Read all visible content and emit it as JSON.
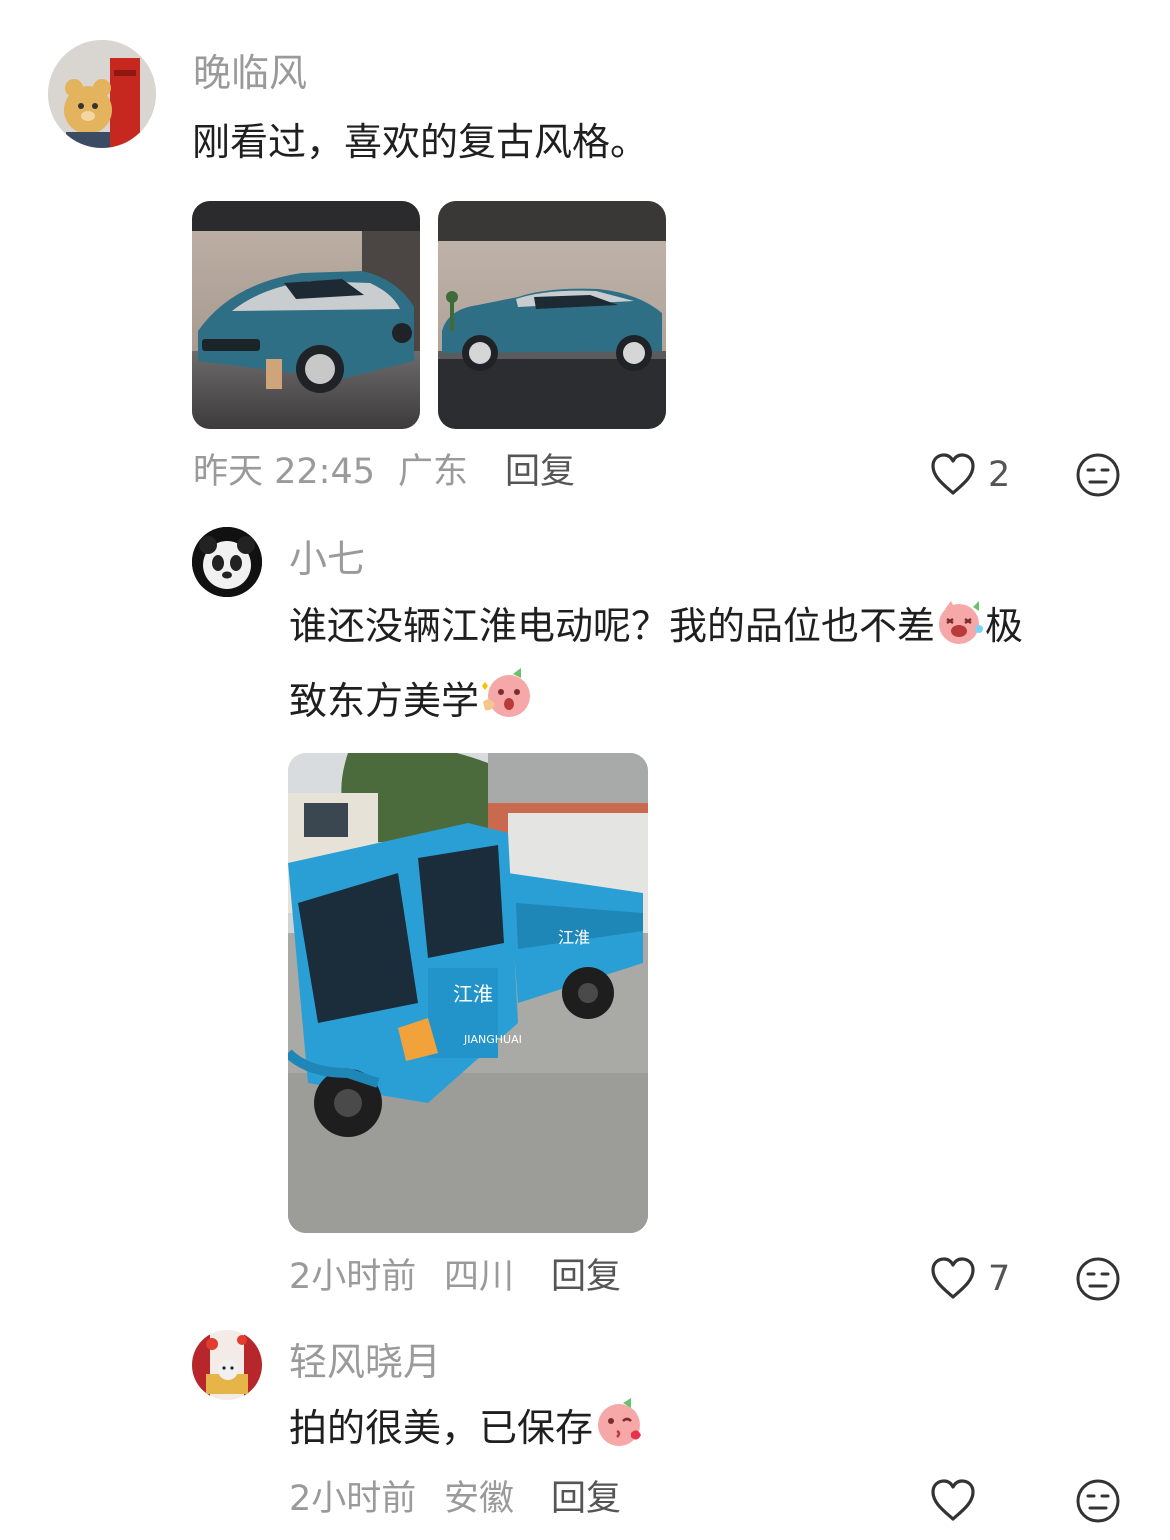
{
  "comments": [
    {
      "username": "晚临风",
      "text": "刚看过，喜欢的复古风格。",
      "time": "昨天 22:45",
      "location": "广东",
      "reply_label": "回复",
      "likes": "2"
    },
    {
      "username": "小七",
      "text_line1": "谁还没辆江淮电动呢？我的品位也不差",
      "text_line1_tail": "极",
      "text_line2": "致东方美学",
      "time": "2小时前",
      "location": "四川",
      "reply_label": "回复",
      "likes": "7",
      "image_text": {
        "brand_cab": "江淮",
        "brand_bed": "江淮",
        "brand_small": "JIANGHUAI"
      }
    },
    {
      "username": "轻风晓月",
      "text": "拍的很美，已保存",
      "time": "2小时前",
      "location": "安徽",
      "reply_label": "回复",
      "likes": ""
    }
  ],
  "icons": {
    "like": "heart-outline-icon",
    "emoji_button": "neutral-face-icon"
  },
  "colors": {
    "car_teal": "#2f6f86",
    "car_silver": "#c9cdd0",
    "tricycle_blue": "#2a9fd6",
    "meta_gray": "#9a9a9a"
  }
}
